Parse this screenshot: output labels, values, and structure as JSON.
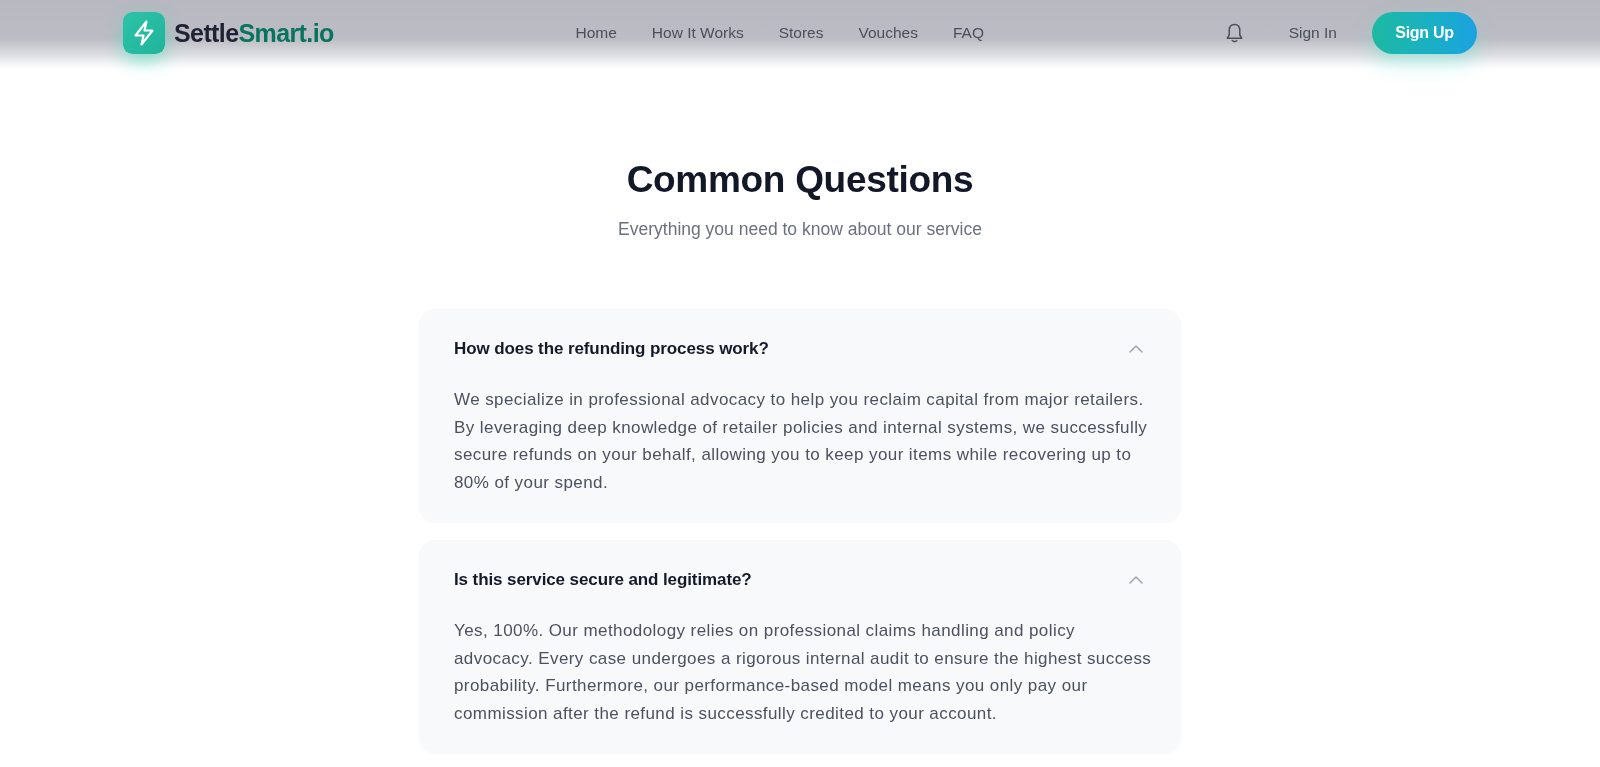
{
  "header": {
    "logo": {
      "name_dark": "Settle",
      "name_accent": "Smart.io"
    },
    "nav": [
      "Home",
      "How It Works",
      "Stores",
      "Vouches",
      "FAQ"
    ],
    "sign_in": "Sign In",
    "sign_up": "Sign Up"
  },
  "faq": {
    "title": "Common Questions",
    "subtitle": "Everything you need to know about our service",
    "items": [
      {
        "question": "How does the refunding process work?",
        "answer": "We specialize in professional advocacy to help you reclaim capital from major retailers. By leveraging deep knowledge of retailer policies and internal systems, we successfully secure refunds on your behalf, allowing you to keep your items while recovering up to 80% of your spend.",
        "expanded": true
      },
      {
        "question": "Is this service secure and legitimate?",
        "answer": "Yes, 100%. Our methodology relies on professional claims handling and policy advocacy. Every case undergoes a rigorous internal audit to ensure the highest success probability. Furthermore, our performance-based model means you only pay our commission after the refund is successfully credited to your account.",
        "expanded": true
      }
    ]
  }
}
